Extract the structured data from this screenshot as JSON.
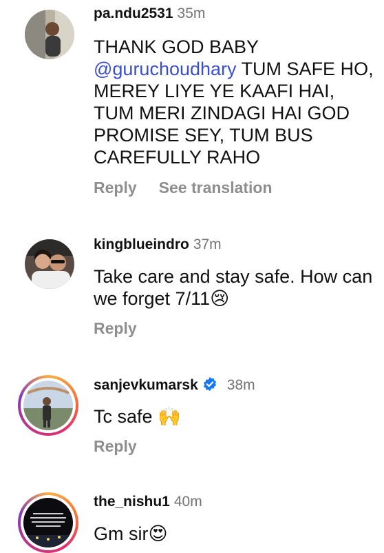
{
  "comments": [
    {
      "username": "pa.ndu2531",
      "time": "35m",
      "mention": "@guruchoudhary",
      "text_before_mention": "THANK GOD BABY",
      "text_after_mention": "TUM SAFE HO, MEREY LIYE YE KAAFI HAI, TUM MERI ZINDAGI HAI GOD PROMISE SEY, TUM BUS CAREFULLY RAHO",
      "reply_label": "Reply",
      "translate_label": "See translation"
    },
    {
      "username": "kingblueindro",
      "time": "37m",
      "text": "Take care and stay safe. How can we forget 7/11😢",
      "reply_label": "Reply"
    },
    {
      "username": "sanjevkumarsk",
      "time": "38m",
      "verified": true,
      "text": "Tc safe 🙌",
      "reply_label": "Reply"
    },
    {
      "username": "the_nishu1",
      "time": "40m",
      "text": "Gm sir😍"
    }
  ],
  "icons": {
    "verified": "verified-badge-icon"
  },
  "colors": {
    "mention": "#3b4ecf",
    "secondary_text": "#8e8e8e",
    "verified": "#1877f2"
  }
}
